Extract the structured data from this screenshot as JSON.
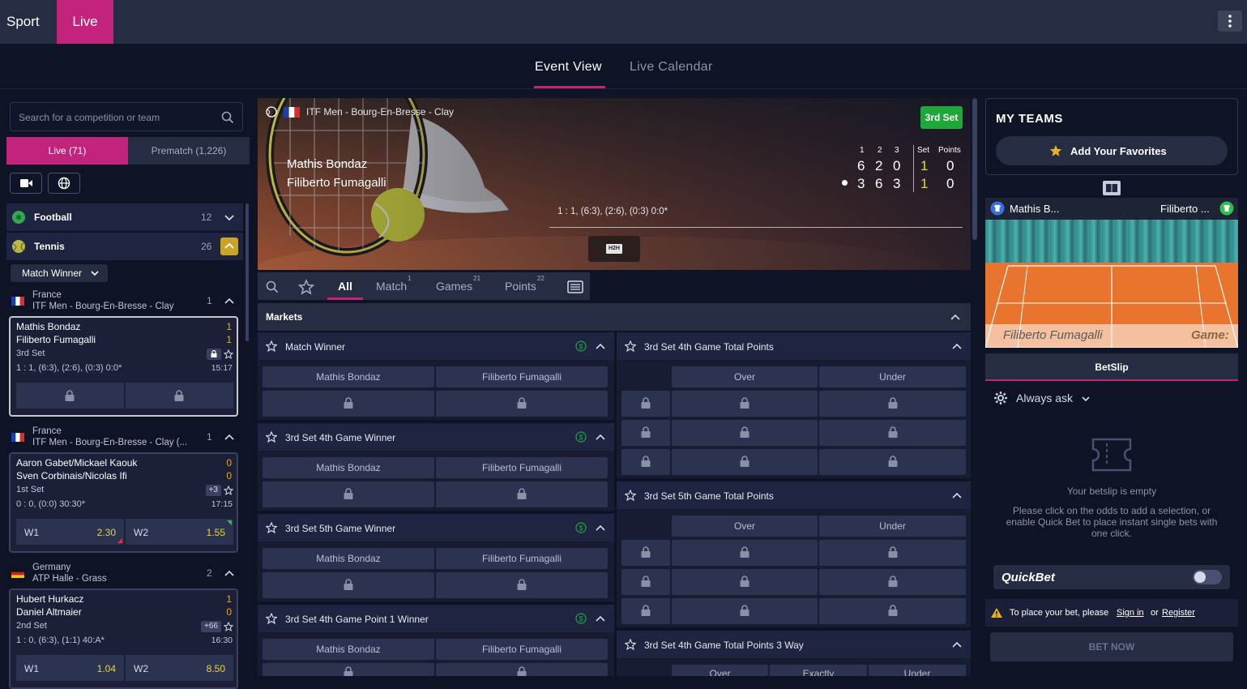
{
  "topbar": {
    "sport": "Sport",
    "live": "Live"
  },
  "subnav": {
    "event_view": "Event View",
    "live_calendar": "Live Calendar"
  },
  "left": {
    "search_placeholder": "Search for a competition or team",
    "live_tab": "Live (71)",
    "prematch_tab": "Prematch (1,226)",
    "sports": [
      {
        "name": "Football",
        "count": "12"
      },
      {
        "name": "Tennis",
        "count": "26"
      }
    ],
    "market_dropdown": "Match Winner",
    "competitions": [
      {
        "country": "France",
        "name": "ITF Men - Bourg-En-Bresse - Clay",
        "count": "1"
      },
      {
        "country": "France",
        "name": "ITF Men - Bourg-En-Bresse - Clay (...",
        "count": "1"
      },
      {
        "country": "Germany",
        "name": "ATP Halle - Grass",
        "count": "2"
      }
    ],
    "matches": [
      {
        "p1": "Mathis Bondaz",
        "p2": "Filiberto Fumagalli",
        "s1": "1",
        "s2": "1",
        "stage": "3rd Set",
        "score": "1 : 1, (6:3), (2:6), (0:3) 0:0*",
        "time": "15:17",
        "badge": ""
      },
      {
        "p1": "Aaron Gabet/Mickael Kaouk",
        "p2": "Sven Corbinais/Nicolas Ifi",
        "s1": "0",
        "s2": "0",
        "stage": "1st Set",
        "score": "0 : 0, (0:0) 30:30*",
        "time": "17:15",
        "badge": "+3",
        "w1_label": "W1",
        "w1": "2.30",
        "w2_label": "W2",
        "w2": "1.55"
      },
      {
        "p1": "Hubert Hurkacz",
        "p2": "Daniel Altmaier",
        "s1": "1",
        "s2": "0",
        "stage": "2nd Set",
        "score": "1 : 0, (6:3), (1:1) 40:A*",
        "time": "16:30",
        "badge": "+66",
        "w1_label": "W1",
        "w1": "1.04",
        "w2_label": "W2",
        "w2": "8.50"
      }
    ]
  },
  "event": {
    "tournament": "ITF Men - Bourg-En-Bresse - Clay",
    "set_badge": "3rd Set",
    "player1": "Mathis Bondaz",
    "player2": "Filiberto Fumagalli",
    "headers": {
      "s1": "1",
      "s2": "2",
      "s3": "3",
      "set": "Set",
      "points": "Points"
    },
    "p1_sets": [
      "6",
      "2",
      "0"
    ],
    "p2_sets": [
      "3",
      "6",
      "3"
    ],
    "p1_set": "1",
    "p2_set": "1",
    "p1_points": "0",
    "p2_points": "0",
    "result": "1 : 1, (6:3), (2:6), (0:3) 0:0*",
    "h2h": "H2H"
  },
  "filters": {
    "all": "All",
    "match": "Match",
    "match_count": "1",
    "games": "Games",
    "games_count": "21",
    "points": "Points",
    "points_count": "22"
  },
  "markets": {
    "title": "Markets",
    "left": [
      {
        "title": "Match Winner",
        "o1": "Mathis Bondaz",
        "o2": "Filiberto Fumagalli"
      },
      {
        "title": "3rd Set 4th Game Winner",
        "o1": "Mathis Bondaz",
        "o2": "Filiberto Fumagalli"
      },
      {
        "title": "3rd Set 5th Game Winner",
        "o1": "Mathis Bondaz",
        "o2": "Filiberto Fumagalli"
      },
      {
        "title": "3rd Set 4th Game Point 1 Winner",
        "o1": "Mathis Bondaz",
        "o2": "Filiberto Fumagalli"
      }
    ],
    "right": [
      {
        "title": "3rd Set 4th Game Total Points",
        "c1": "Over",
        "c2": "Under"
      },
      {
        "title": "3rd Set 5th Game Total Points",
        "c1": "Over",
        "c2": "Under"
      },
      {
        "title": "3rd Set 4th Game Total Points 3 Way",
        "c1": "Over",
        "c2": "Exactly",
        "c3": "Under"
      }
    ]
  },
  "right": {
    "my_teams": "MY TEAMS",
    "add_favorites": "Add Your Favorites",
    "vis_p1": "Mathis B...",
    "vis_p2": "Filiberto ...",
    "vis_caption": "Filiberto Fumagalli",
    "vis_game": "Game:",
    "betslip": "BetSlip",
    "always_ask": "Always ask",
    "empty_title": "Your betslip is empty",
    "empty_desc": "Please click on the odds to add a selection, or enable Quick Bet to place instant single bets with one click.",
    "quickbet": "QuickBet",
    "warn_text": "To place your bet, please",
    "sign_in": "Sign in",
    "or": "or",
    "register": "Register",
    "bet_now": "BET NOW"
  }
}
